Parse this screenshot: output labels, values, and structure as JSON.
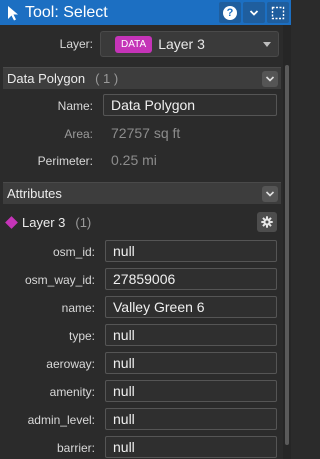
{
  "titlebar": {
    "title": "Tool: Select",
    "icons": [
      "pointer-icon",
      "help-icon",
      "chevron-down-icon",
      "select-region-icon"
    ]
  },
  "layer_picker": {
    "label": "Layer:",
    "badge": "DATA",
    "value": "Layer 3"
  },
  "data_polygon": {
    "header": "Data Polygon",
    "count": "( 1 )",
    "fields": [
      {
        "label": "Name:",
        "value": "Data Polygon",
        "editable": true
      },
      {
        "label": "Area:",
        "value": "72757 sq ft",
        "editable": false
      },
      {
        "label": "Perimeter:",
        "value": "0.25 mi",
        "editable": false
      }
    ]
  },
  "attributes": {
    "header": "Attributes",
    "layer_name": "Layer 3",
    "layer_count": "(1)",
    "rows": [
      {
        "label": "osm_id:",
        "value": "null"
      },
      {
        "label": "osm_way_id:",
        "value": "27859006"
      },
      {
        "label": "name:",
        "value": "Valley Green 6"
      },
      {
        "label": "type:",
        "value": "null"
      },
      {
        "label": "aeroway:",
        "value": "null"
      },
      {
        "label": "amenity:",
        "value": "null"
      },
      {
        "label": "admin_level:",
        "value": "null"
      },
      {
        "label": "barrier:",
        "value": "null"
      }
    ]
  },
  "colors": {
    "titlebar": "#1c6fc2",
    "badge": "#c534b8",
    "panel": "#2b2b2b"
  }
}
